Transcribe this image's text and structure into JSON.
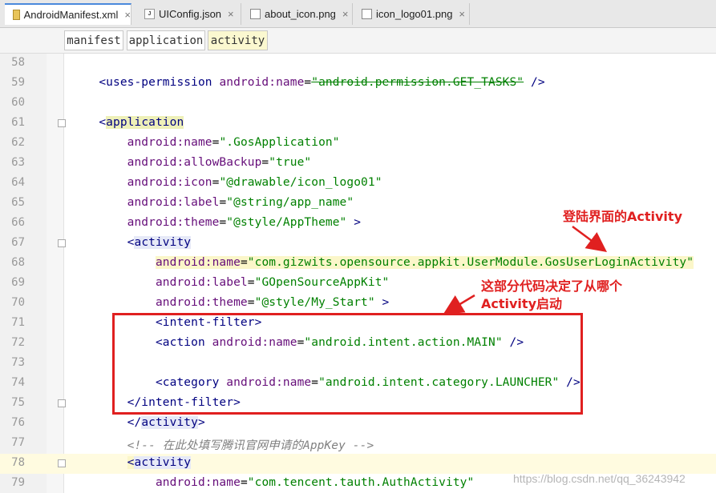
{
  "tabs": [
    {
      "label": "AndroidManifest.xml",
      "icon": "xml-file-icon",
      "active": true
    },
    {
      "label": "UIConfig.json",
      "icon": "json-file-icon",
      "active": false
    },
    {
      "label": "about_icon.png",
      "icon": "image-file-icon",
      "active": false
    },
    {
      "label": "icon_logo01.png",
      "icon": "image-file-icon",
      "active": false
    }
  ],
  "close_glyph": "×",
  "breadcrumbs": [
    "manifest",
    "application",
    "activity"
  ],
  "lines": [
    {
      "num": "58"
    },
    {
      "num": "59",
      "indent": "    ",
      "t1": "<uses-permission ",
      "a1": "android:name",
      "p1": "=",
      "v1": "\"android.permission.GET_TASKS\"",
      "t2": " />"
    },
    {
      "num": "60"
    },
    {
      "num": "61",
      "indent": "    ",
      "t1": "<",
      "t2": "application"
    },
    {
      "num": "62",
      "indent": "        ",
      "a1": "android:name",
      "p1": "=",
      "v1": "\".GosApplication\""
    },
    {
      "num": "63",
      "indent": "        ",
      "a1": "android:allowBackup",
      "p1": "=",
      "v1": "\"true\""
    },
    {
      "num": "64",
      "indent": "        ",
      "a1": "android:icon",
      "p1": "=",
      "v1": "\"@drawable/icon_logo01\""
    },
    {
      "num": "65",
      "indent": "        ",
      "a1": "android:label",
      "p1": "=",
      "v1": "\"@string/app_name\""
    },
    {
      "num": "66",
      "indent": "        ",
      "a1": "android:theme",
      "p1": "=",
      "v1": "\"@style/AppTheme\"",
      "t2": " >"
    },
    {
      "num": "67",
      "indent": "        ",
      "t1": "<",
      "t2": "activity"
    },
    {
      "num": "68",
      "indent": "            ",
      "a1": "android:name",
      "p1": "=",
      "v1": "\"com.gizwits.opensource.appkit.UserModule.GosUserLoginActivity\""
    },
    {
      "num": "69",
      "indent": "            ",
      "a1": "android:label",
      "p1": "=",
      "v1": "\"GOpenSourceAppKit\""
    },
    {
      "num": "70",
      "indent": "            ",
      "a1": "android:theme",
      "p1": "=",
      "v1": "\"@style/My_Start\"",
      "t2": " >"
    },
    {
      "num": "71",
      "indent": "            ",
      "t1": "<intent-filter>"
    },
    {
      "num": "72",
      "indent": "            ",
      "t1": "<action ",
      "a1": "android:name",
      "p1": "=",
      "v1": "\"android.intent.action.MAIN\"",
      "t2": " />"
    },
    {
      "num": "73"
    },
    {
      "num": "74",
      "indent": "            ",
      "t1": "<category ",
      "a1": "android:name",
      "p1": "=",
      "v1": "\"android.intent.category.LAUNCHER\"",
      "t2": " />"
    },
    {
      "num": "75",
      "indent": "        ",
      "t1": "</intent-filter>"
    },
    {
      "num": "76",
      "indent": "        ",
      "t1": "</",
      "t2": "activity",
      "t3": ">"
    },
    {
      "num": "77",
      "indent": "        ",
      "c1": "<!-- 在此处填写腾讯官网申请的AppKey -->"
    },
    {
      "num": "78",
      "indent": "        ",
      "t1": "<",
      "t2": "activity"
    },
    {
      "num": "79",
      "indent": "            ",
      "a1": "android:name",
      "p1": "=",
      "v1": "\"com.tencent.tauth.AuthActivity\""
    }
  ],
  "annotations": {
    "note1": "登陆界面的Activity",
    "note2_line1": "这部分代码决定了从哪个",
    "note2_line2": "Activity启动",
    "color": "#e02020"
  },
  "watermark": "https://blog.csdn.net/qq_36243942"
}
